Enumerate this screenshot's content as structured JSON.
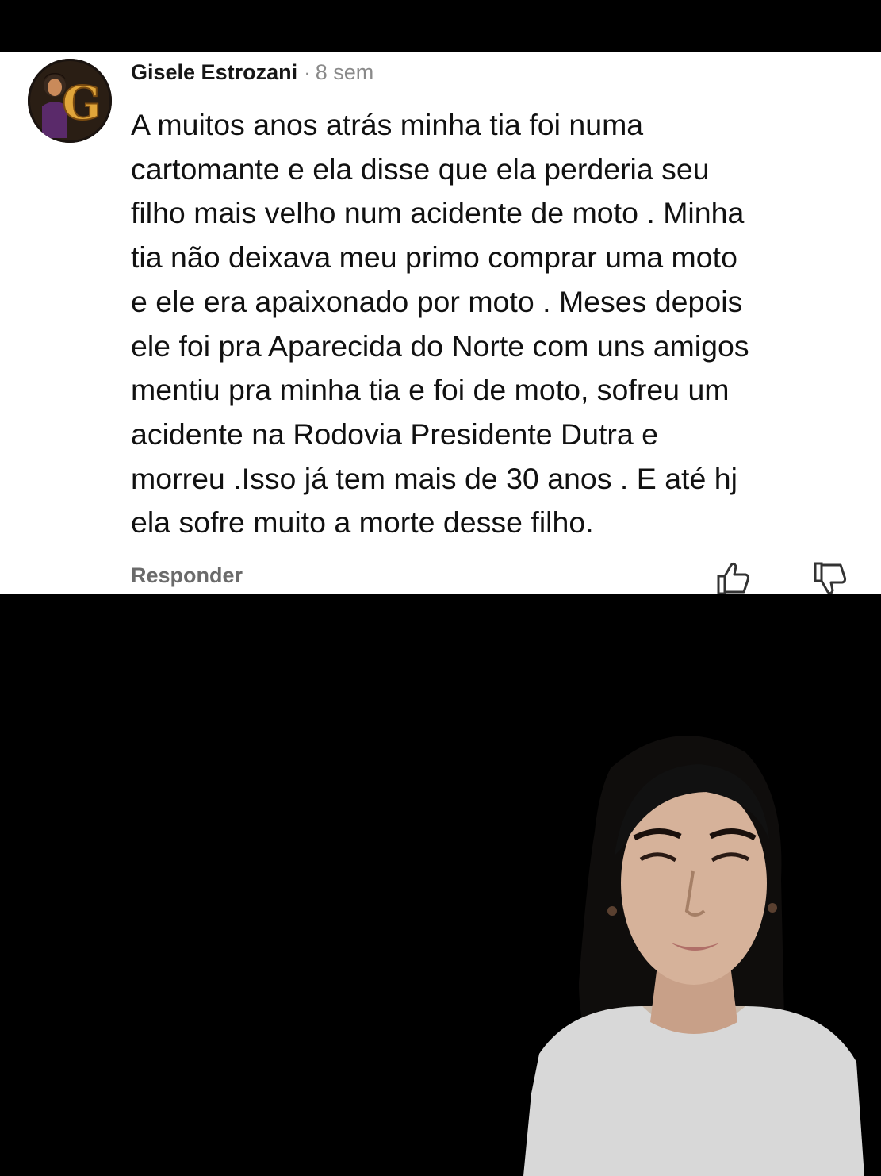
{
  "comment": {
    "author": "Gisele Estrozani",
    "separator": "·",
    "timestamp": "8 sem",
    "lines": [
      "A muitos anos atrás minha tia foi numa",
      "cartomante e ela disse que ela perderia seu",
      "filho mais velho num acidente de moto . Minha",
      "tia não deixava meu primo comprar uma moto",
      "e ele era apaixonado por moto . Meses depois",
      "ele foi pra Aparecida do Norte com uns amigos",
      "mentiu pra minha tia e foi de moto,  sofreu um",
      "acidente na Rodovia Presidente Dutra e",
      "morreu .Isso já tem mais de 30 anos . E até hj",
      "ela sofre muito a morte desse filho."
    ],
    "reply_label": "Responder",
    "avatar_letter": "G"
  },
  "icons": {
    "like": "thumbs-up-icon",
    "dislike": "thumbs-down-icon"
  },
  "colors": {
    "card_background": "#ffffff",
    "page_background": "#000000",
    "meta_text": "#8a8a8a",
    "avatar_letter": "#e0a53a"
  }
}
